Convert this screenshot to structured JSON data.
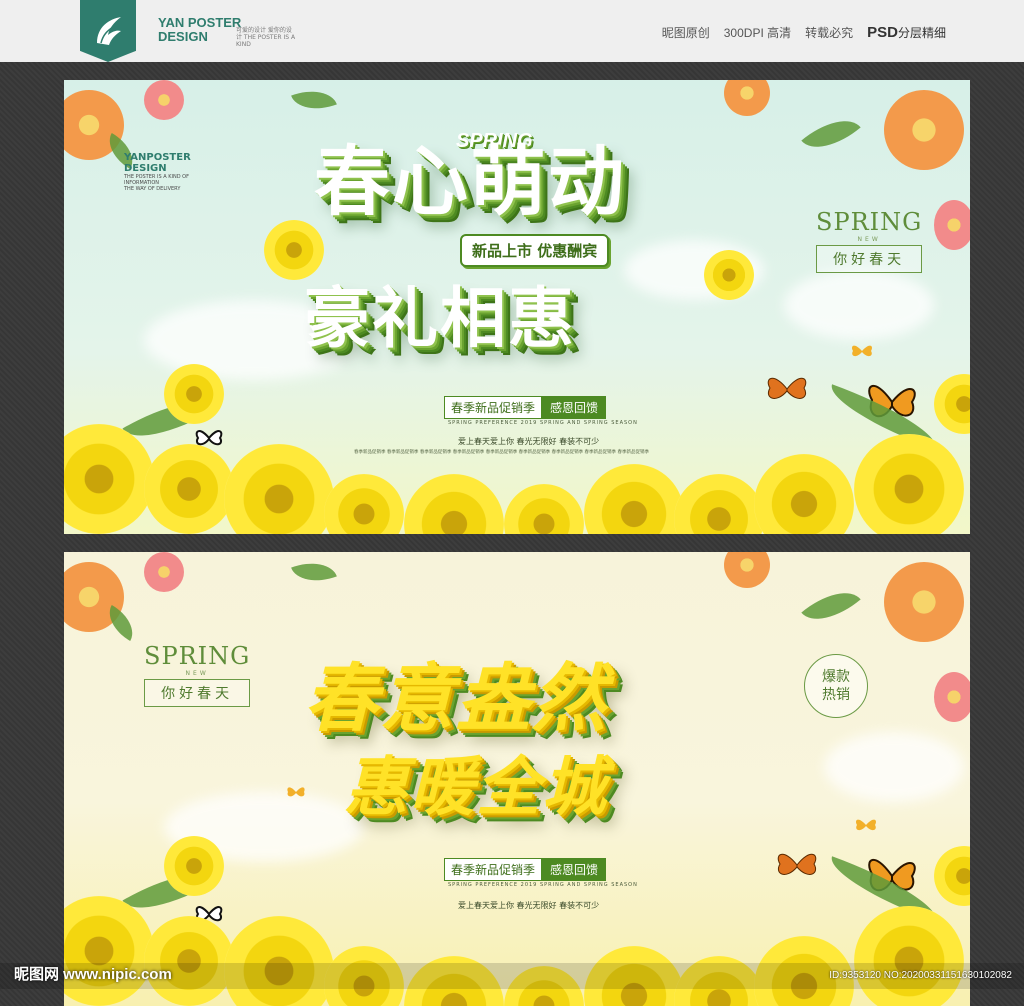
{
  "header": {
    "brand_line1": "YAN POSTER",
    "brand_line2": "DESIGN",
    "tagline": "可爱的设计 爱你的设计 THE POSTER IS A KIND",
    "links": [
      "昵图原创",
      "300DPI 高清",
      "转载必究"
    ],
    "psd_big": "PSD",
    "psd_small": "分层精细"
  },
  "poster1": {
    "logo_line1": "YANPOSTER",
    "logo_line2": "DESIGN",
    "logo_small": [
      "THE POSTER IS A KIND OF",
      "INFORMATION",
      "THE WAY OF DELIVERY"
    ],
    "spring_word": "SPRING",
    "title_line1": "春心萌动",
    "title_line2": "豪礼相惠",
    "pill": "新品上市 优惠酬宾",
    "badge_spring": "SPRING",
    "badge_new": "NEW",
    "badge_hello": "你好春天",
    "tag_a": "春季新品促销季",
    "tag_b": "感恩回馈",
    "eng": "SPRING PREFERENCE 2019 SPRING AND SPRING SEASON",
    "slogan": "爱上春天爱上你  春光无限好  春装不可少",
    "fine": "春季新品促销季 春季新品促销季 春季新品促销季 春季新品促销季 春季新品促销季 春季新品促销季 春季新品促销季 春季新品促销季 春季新品促销季"
  },
  "poster2": {
    "badge_spring": "SPRING",
    "badge_new": "NEW",
    "badge_hello": "你好春天",
    "title_line1": "春意盎然",
    "title_line2": "惠暖全城",
    "bubble_line1": "爆款",
    "bubble_line2": "热销",
    "tag_a": "春季新品促销季",
    "tag_b": "感恩回馈",
    "eng": "SPRING PREFERENCE 2019 SPRING AND SPRING SEASON",
    "slogan": "爱上春天爱上你  春光无限好  春装不可少"
  },
  "watermark": {
    "left": "昵图网 www.nipic.com",
    "right": "ID:9353120 NO:20200331151630102082"
  },
  "colors": {
    "brand": "#2f7d6e",
    "green": "#4d8a22",
    "yellow": "#ffe227"
  }
}
